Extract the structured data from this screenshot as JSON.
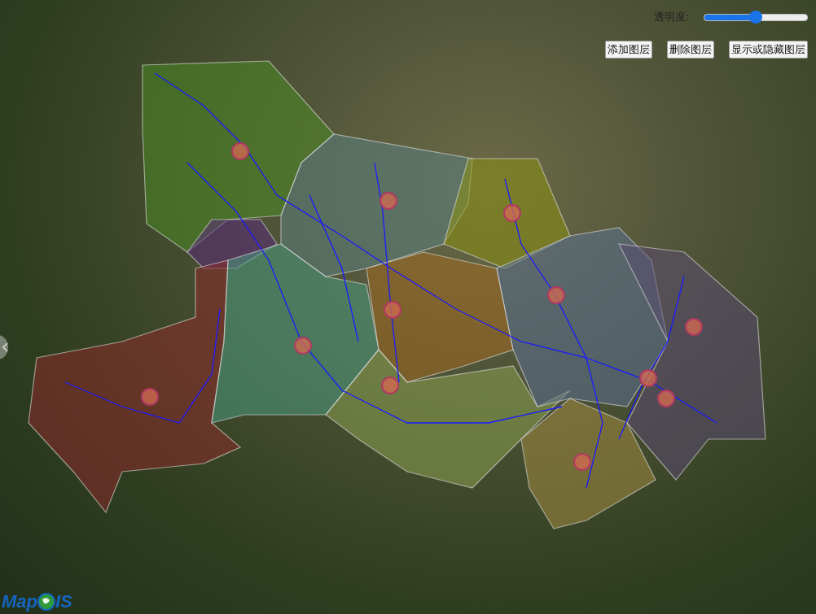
{
  "opacity_control": {
    "label": "透明度:",
    "level": 0.5
  },
  "buttons": [
    {
      "label": "添加图层"
    },
    {
      "label": "删除图层"
    },
    {
      "label": "显示或隐藏图层"
    }
  ],
  "logo": {
    "before": "Map",
    "after": "IS"
  }
}
